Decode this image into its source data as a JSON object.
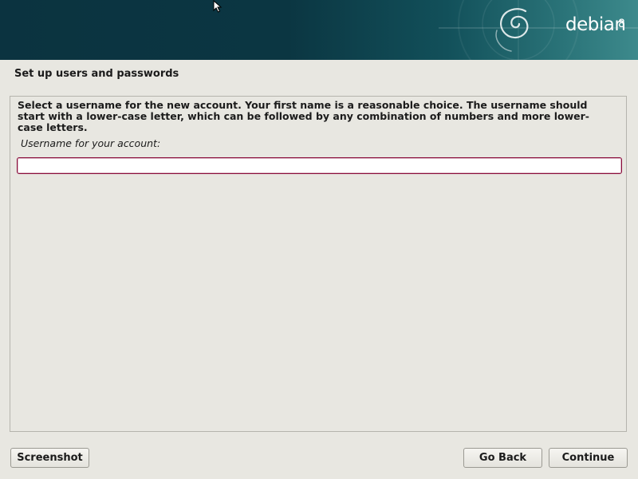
{
  "banner": {
    "logo_text": "debian",
    "logo_version": "8",
    "icon": "debian-swirl-icon"
  },
  "page": {
    "title": "Set up users and passwords"
  },
  "form": {
    "description": "Select a username for the new account. Your first name is a reasonable choice. The username should start with a lower-case letter, which can be followed by any combination of numbers and more lower-case letters.",
    "field_label": "Username for your account:",
    "username_value": ""
  },
  "buttons": {
    "screenshot": "Screenshot",
    "go_back": "Go Back",
    "continue": "Continue"
  },
  "colors": {
    "banner_dark": "#0b3340",
    "banner_light": "#3d8a8c",
    "input_border": "#8a0c3a",
    "background": "#e8e7e1"
  }
}
